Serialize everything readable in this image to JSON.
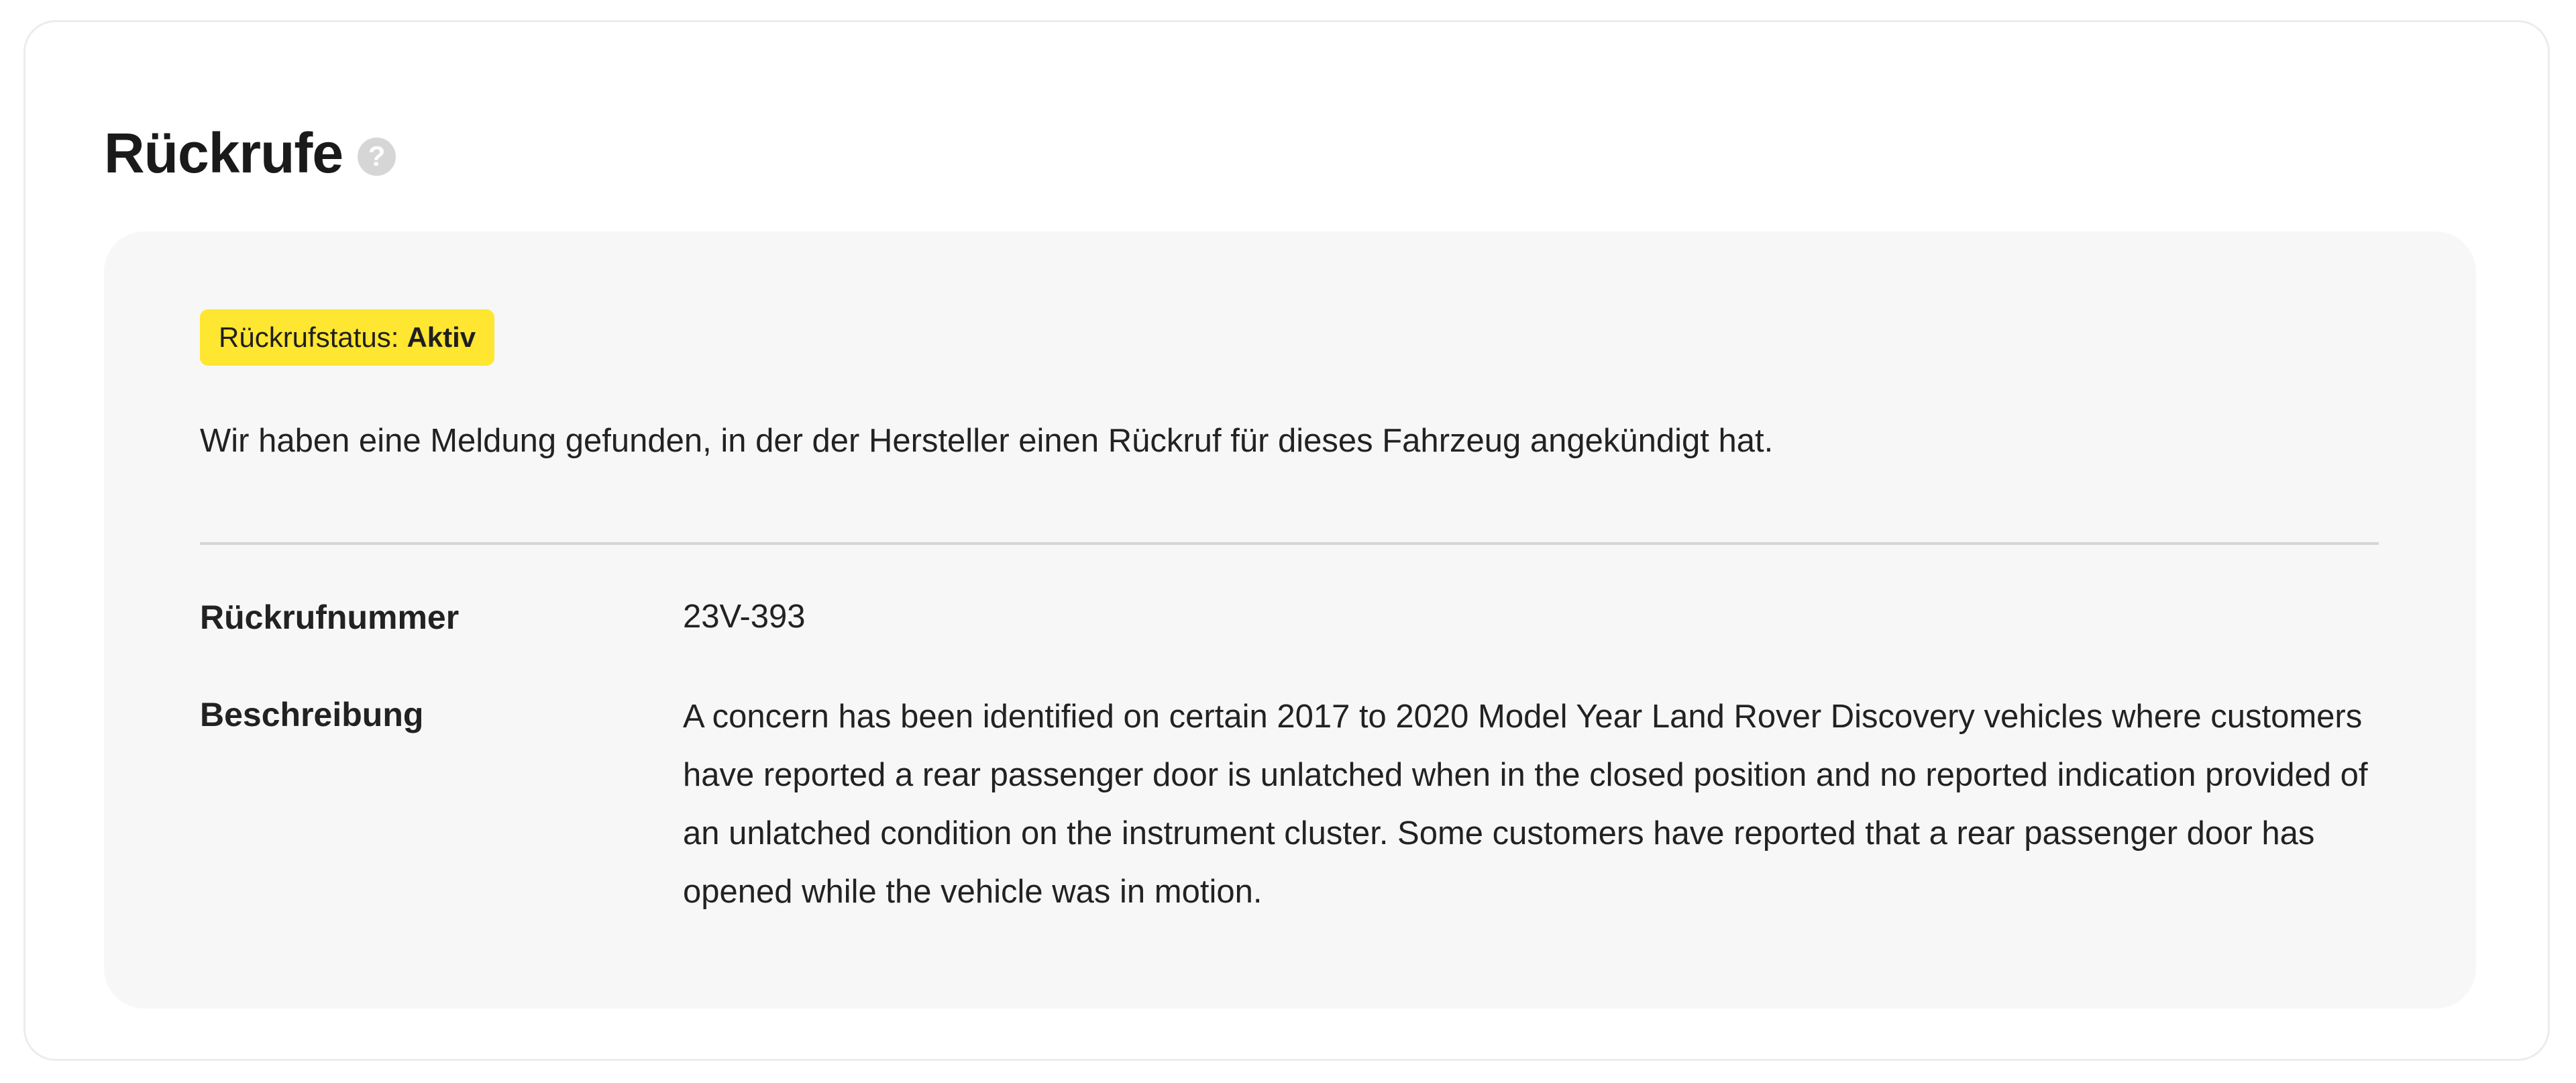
{
  "section": {
    "title": "Rückrufe",
    "help_icon_glyph": "?"
  },
  "recall": {
    "status_label": "Rückrufstatus:",
    "status_value": "Aktiv",
    "status_color": "#ffe631",
    "intro": "Wir haben eine Meldung gefunden, in der der Hersteller einen Rückruf für dieses Fahrzeug angekündigt hat.",
    "details": {
      "number_label": "Rückrufnummer",
      "number_value": "23V-393",
      "description_label": "Beschreibung",
      "description_value": "A concern has been identified on certain 2017 to 2020 Model Year Land Rover Discovery vehicles where customers have reported a rear passenger door is unlatched when in the closed position and no reported indication provided of an unlatched condition on the instrument cluster. Some customers have reported that a rear passenger door has opened while the vehicle was in motion."
    }
  }
}
